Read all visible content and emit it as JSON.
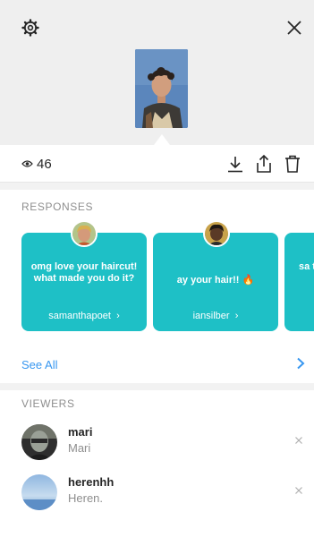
{
  "header": {
    "settings_icon": "gear-icon",
    "close_icon": "close-icon"
  },
  "stats": {
    "view_count": "46",
    "actions": [
      "download-icon",
      "share-icon",
      "trash-icon"
    ]
  },
  "responses": {
    "title": "RESPONSES",
    "items": [
      {
        "message": "omg love your haircut! what made you do it?",
        "username": "samanthapoet"
      },
      {
        "message": "ay your hair!! 🔥",
        "username": "iansilber"
      },
      {
        "message": "sa te",
        "username": ""
      }
    ],
    "see_all": "See All"
  },
  "viewers": {
    "title": "VIEWERS",
    "items": [
      {
        "username": "mari",
        "name": "Mari"
      },
      {
        "username": "herenhh",
        "name": "Heren."
      }
    ]
  },
  "colors": {
    "accent": "#1ec0c6",
    "link": "#3897f0",
    "muted": "#8e8e8e"
  }
}
